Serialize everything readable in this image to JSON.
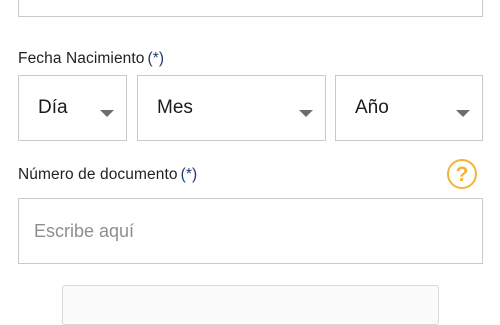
{
  "birthdate": {
    "label": "Fecha Nacimiento",
    "required_marker": "(*)",
    "day_select": {
      "selected": "Día"
    },
    "month_select": {
      "selected": "Mes"
    },
    "year_select": {
      "selected": "Año"
    }
  },
  "document": {
    "label": "Número de documento",
    "required_marker": "(*)",
    "help_icon": "question-circle-icon",
    "help_symbol": "?",
    "input_placeholder": "Escribe aquí",
    "input_value": ""
  },
  "colors": {
    "required_marker": "#1e3c6e",
    "help_icon": "#f2b636",
    "border": "#c9c9c9",
    "placeholder": "#8e8e8e"
  }
}
